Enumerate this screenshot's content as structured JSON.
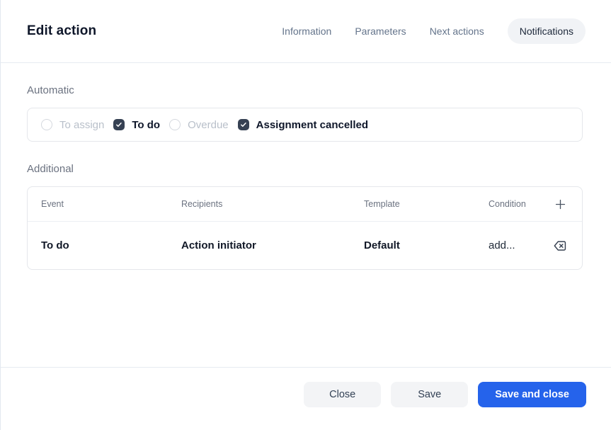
{
  "header": {
    "title": "Edit action",
    "tabs": [
      {
        "label": "Information",
        "active": false
      },
      {
        "label": "Parameters",
        "active": false
      },
      {
        "label": "Next actions",
        "active": false
      },
      {
        "label": "Notifications",
        "active": true
      }
    ]
  },
  "automatic": {
    "label": "Automatic",
    "options": [
      {
        "label": "To assign",
        "checked": false
      },
      {
        "label": "To do",
        "checked": true
      },
      {
        "label": "Overdue",
        "checked": false
      },
      {
        "label": "Assignment cancelled",
        "checked": true
      }
    ]
  },
  "additional": {
    "label": "Additional",
    "columns": [
      "Event",
      "Recipients",
      "Template",
      "Condition"
    ],
    "rows": [
      {
        "event": "To do",
        "recipients": "Action initiator",
        "template": "Default",
        "condition": "add..."
      }
    ]
  },
  "footer": {
    "close_label": "Close",
    "save_label": "Save",
    "save_and_close_label": "Save and close"
  },
  "colors": {
    "accent": "#2563eb",
    "checkbox_checked": "#364153",
    "active_tab_bg": "#f1f3f6",
    "muted_text": "#6b7280",
    "border": "#e5e7eb"
  }
}
